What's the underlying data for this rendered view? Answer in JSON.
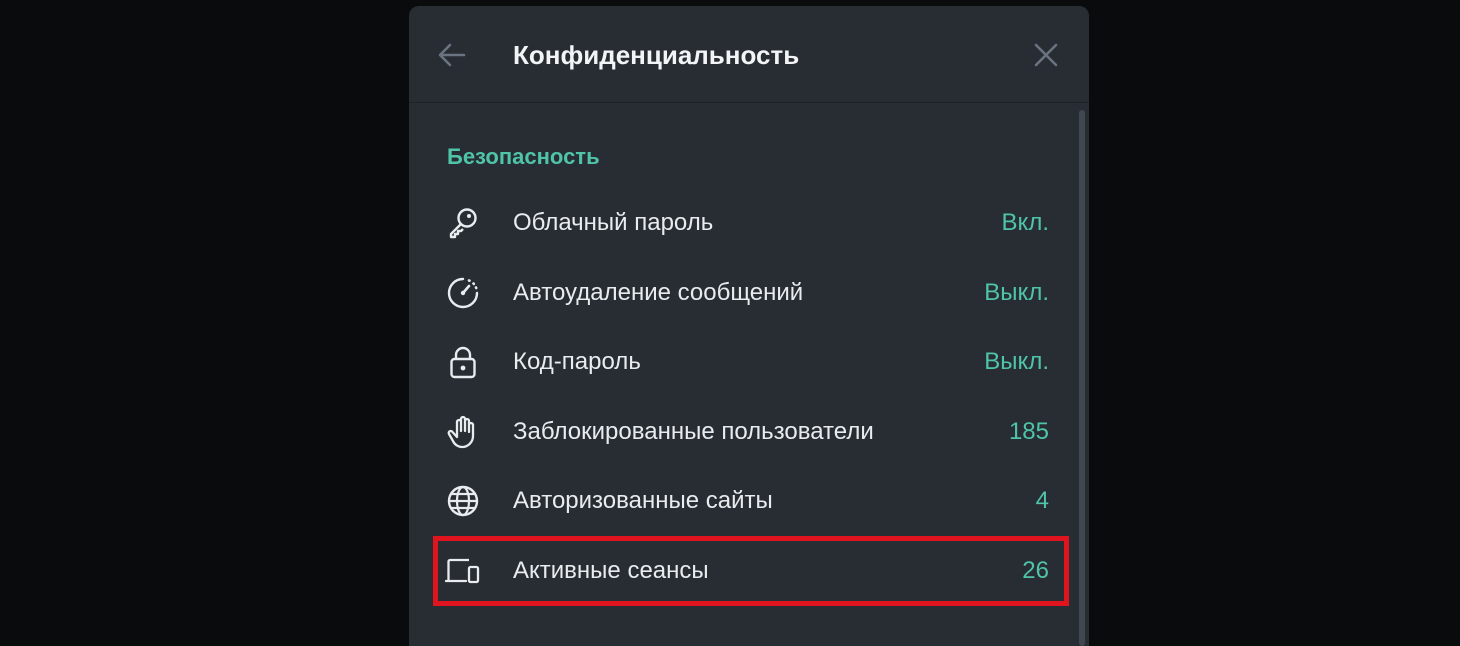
{
  "dialog": {
    "title": "Конфиденциальность"
  },
  "icons": {
    "back": "arrow-left-icon",
    "close": "close-icon"
  },
  "colors": {
    "accent": "#4fc4a7",
    "panel_bg": "#272d33",
    "page_bg": "#0a0b0d",
    "highlight": "#e0141f"
  },
  "security": {
    "section_title": "Безопасность",
    "items": [
      {
        "label": "Облачный пароль",
        "value": "Вкл.",
        "icon": "key-icon"
      },
      {
        "label": "Автоудаление сообщений",
        "value": "Выкл.",
        "icon": "timer-icon"
      },
      {
        "label": "Код-пароль",
        "value": "Выкл.",
        "icon": "lock-icon"
      },
      {
        "label": "Заблокированные пользователи",
        "value": "185",
        "icon": "hand-icon"
      },
      {
        "label": "Авторизованные сайты",
        "value": "4",
        "icon": "globe-icon"
      },
      {
        "label": "Активные сеансы",
        "value": "26",
        "icon": "devices-icon"
      }
    ]
  }
}
